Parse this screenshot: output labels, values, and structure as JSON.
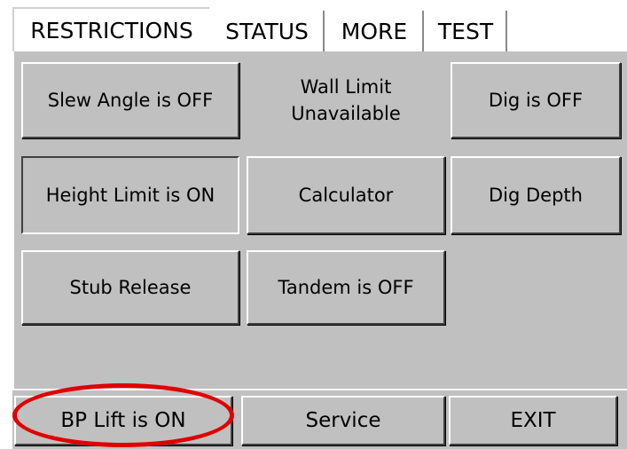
{
  "tabs": [
    {
      "label": "RESTRICTIONS",
      "active": true
    },
    {
      "label": "STATUS",
      "active": false
    },
    {
      "label": "MORE",
      "active": false
    },
    {
      "label": "TEST",
      "active": false
    }
  ],
  "restrictions": {
    "slew_angle": "Slew Angle is OFF",
    "wall_limit": "Wall Limit Unavailable",
    "dig": "Dig is OFF",
    "height_limit": "Height Limit is ON",
    "calculator": "Calculator",
    "dig_depth": "Dig Depth",
    "stub_release": "Stub Release",
    "tandem": "Tandem is OFF"
  },
  "bottom": {
    "bp_lift": "BP Lift is ON",
    "service": "Service",
    "exit": "EXIT"
  },
  "colors": {
    "panel": "#c0c0c0",
    "highlight": "#e00000"
  }
}
